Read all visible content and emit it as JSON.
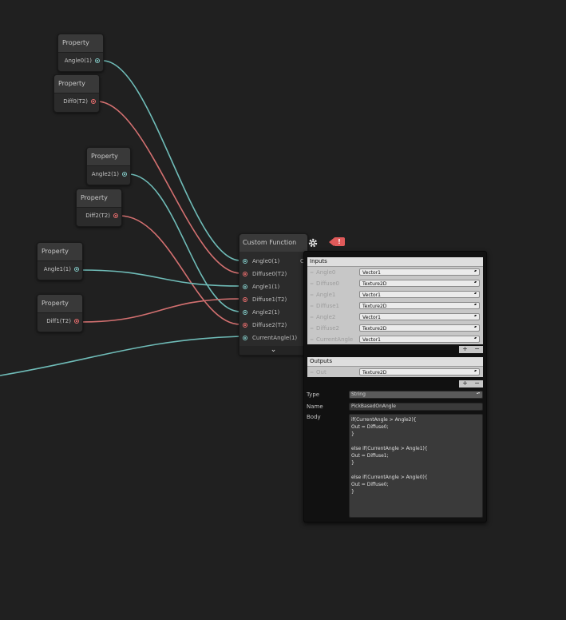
{
  "property_nodes": [
    {
      "title": "Property",
      "port": "Angle0(1)",
      "kind": "vector"
    },
    {
      "title": "Property",
      "port": "Diff0(T2)",
      "kind": "texture"
    },
    {
      "title": "Property",
      "port": "Angle2(1)",
      "kind": "vector"
    },
    {
      "title": "Property",
      "port": "Diff2(T2)",
      "kind": "texture"
    },
    {
      "title": "Property",
      "port": "Angle1(1)",
      "kind": "vector"
    },
    {
      "title": "Property",
      "port": "Diff1(T2)",
      "kind": "texture"
    }
  ],
  "custom_function": {
    "title": "Custom Function",
    "output_letter": "O",
    "collapse_icon": "chevron-down-icon",
    "inputs": [
      {
        "label": "Angle0(1)",
        "kind": "vector"
      },
      {
        "label": "Diffuse0(T2)",
        "kind": "texture"
      },
      {
        "label": "Angle1(1)",
        "kind": "vector"
      },
      {
        "label": "Diffuse1(T2)",
        "kind": "texture"
      },
      {
        "label": "Angle2(1)",
        "kind": "vector"
      },
      {
        "label": "Diffuse2(T2)",
        "kind": "texture"
      },
      {
        "label": "CurrentAngle(1)",
        "kind": "vector"
      }
    ],
    "warning": "!"
  },
  "panel": {
    "inputs_header": "Inputs",
    "inputs": [
      {
        "name": "Angle0",
        "type": "Vector1"
      },
      {
        "name": "Diffuse0",
        "type": "Texture2D"
      },
      {
        "name": "Angle1",
        "type": "Vector1"
      },
      {
        "name": "Diffuse1",
        "type": "Texture2D"
      },
      {
        "name": "Angle2",
        "type": "Vector1"
      },
      {
        "name": "Diffuse2",
        "type": "Texture2D"
      },
      {
        "name": "CurrentAngle",
        "type": "Vector1"
      }
    ],
    "outputs_header": "Outputs",
    "outputs": [
      {
        "name": "Out",
        "type": "Texture2D"
      }
    ],
    "add_label": "+",
    "remove_label": "−",
    "type_label": "Type",
    "type_value": "String",
    "name_label": "Name",
    "name_value": "PickBasedOnAngle",
    "body_label": "Body",
    "body_value": "if(CurrentAngle > Angle2){\nOut = Diffuse0;\n}\n\nelse if(CurrentAngle > Angle1){\nOut = Diffuse1;\n}\n\nelse if(CurrentAngle > Angle0){\nOut = Diffuse0;\n}"
  },
  "colors": {
    "background": "#202020",
    "vector_wire": "#6fbcb8",
    "texture_wire": "#d37070",
    "warning": "#e05a5a"
  }
}
